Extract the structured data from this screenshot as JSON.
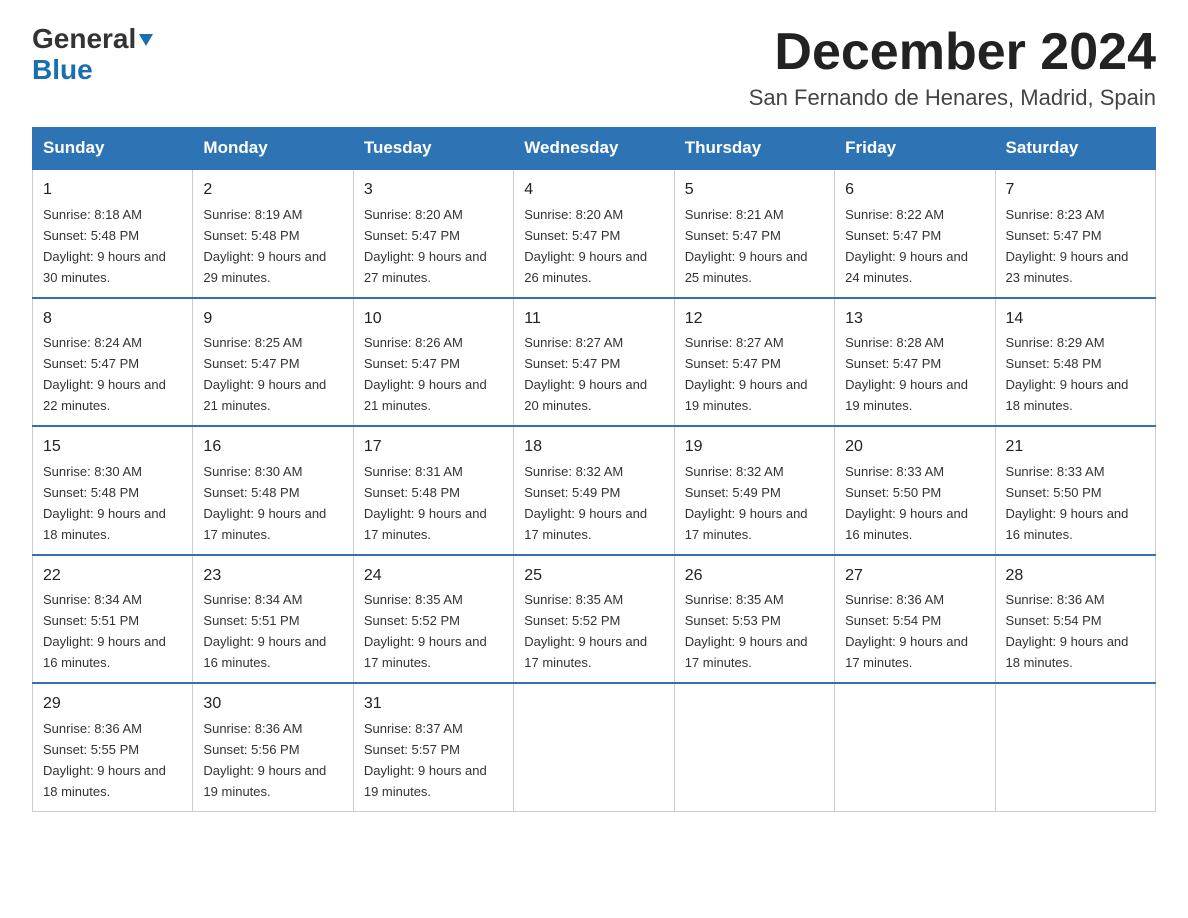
{
  "logo": {
    "general": "General",
    "blue": "Blue"
  },
  "title": {
    "month_year": "December 2024",
    "location": "San Fernando de Henares, Madrid, Spain"
  },
  "weekdays": [
    "Sunday",
    "Monday",
    "Tuesday",
    "Wednesday",
    "Thursday",
    "Friday",
    "Saturday"
  ],
  "weeks": [
    [
      {
        "day": "1",
        "sunrise": "8:18 AM",
        "sunset": "5:48 PM",
        "daylight": "9 hours and 30 minutes."
      },
      {
        "day": "2",
        "sunrise": "8:19 AM",
        "sunset": "5:48 PM",
        "daylight": "9 hours and 29 minutes."
      },
      {
        "day": "3",
        "sunrise": "8:20 AM",
        "sunset": "5:47 PM",
        "daylight": "9 hours and 27 minutes."
      },
      {
        "day": "4",
        "sunrise": "8:20 AM",
        "sunset": "5:47 PM",
        "daylight": "9 hours and 26 minutes."
      },
      {
        "day": "5",
        "sunrise": "8:21 AM",
        "sunset": "5:47 PM",
        "daylight": "9 hours and 25 minutes."
      },
      {
        "day": "6",
        "sunrise": "8:22 AM",
        "sunset": "5:47 PM",
        "daylight": "9 hours and 24 minutes."
      },
      {
        "day": "7",
        "sunrise": "8:23 AM",
        "sunset": "5:47 PM",
        "daylight": "9 hours and 23 minutes."
      }
    ],
    [
      {
        "day": "8",
        "sunrise": "8:24 AM",
        "sunset": "5:47 PM",
        "daylight": "9 hours and 22 minutes."
      },
      {
        "day": "9",
        "sunrise": "8:25 AM",
        "sunset": "5:47 PM",
        "daylight": "9 hours and 21 minutes."
      },
      {
        "day": "10",
        "sunrise": "8:26 AM",
        "sunset": "5:47 PM",
        "daylight": "9 hours and 21 minutes."
      },
      {
        "day": "11",
        "sunrise": "8:27 AM",
        "sunset": "5:47 PM",
        "daylight": "9 hours and 20 minutes."
      },
      {
        "day": "12",
        "sunrise": "8:27 AM",
        "sunset": "5:47 PM",
        "daylight": "9 hours and 19 minutes."
      },
      {
        "day": "13",
        "sunrise": "8:28 AM",
        "sunset": "5:47 PM",
        "daylight": "9 hours and 19 minutes."
      },
      {
        "day": "14",
        "sunrise": "8:29 AM",
        "sunset": "5:48 PM",
        "daylight": "9 hours and 18 minutes."
      }
    ],
    [
      {
        "day": "15",
        "sunrise": "8:30 AM",
        "sunset": "5:48 PM",
        "daylight": "9 hours and 18 minutes."
      },
      {
        "day": "16",
        "sunrise": "8:30 AM",
        "sunset": "5:48 PM",
        "daylight": "9 hours and 17 minutes."
      },
      {
        "day": "17",
        "sunrise": "8:31 AM",
        "sunset": "5:48 PM",
        "daylight": "9 hours and 17 minutes."
      },
      {
        "day": "18",
        "sunrise": "8:32 AM",
        "sunset": "5:49 PM",
        "daylight": "9 hours and 17 minutes."
      },
      {
        "day": "19",
        "sunrise": "8:32 AM",
        "sunset": "5:49 PM",
        "daylight": "9 hours and 17 minutes."
      },
      {
        "day": "20",
        "sunrise": "8:33 AM",
        "sunset": "5:50 PM",
        "daylight": "9 hours and 16 minutes."
      },
      {
        "day": "21",
        "sunrise": "8:33 AM",
        "sunset": "5:50 PM",
        "daylight": "9 hours and 16 minutes."
      }
    ],
    [
      {
        "day": "22",
        "sunrise": "8:34 AM",
        "sunset": "5:51 PM",
        "daylight": "9 hours and 16 minutes."
      },
      {
        "day": "23",
        "sunrise": "8:34 AM",
        "sunset": "5:51 PM",
        "daylight": "9 hours and 16 minutes."
      },
      {
        "day": "24",
        "sunrise": "8:35 AM",
        "sunset": "5:52 PM",
        "daylight": "9 hours and 17 minutes."
      },
      {
        "day": "25",
        "sunrise": "8:35 AM",
        "sunset": "5:52 PM",
        "daylight": "9 hours and 17 minutes."
      },
      {
        "day": "26",
        "sunrise": "8:35 AM",
        "sunset": "5:53 PM",
        "daylight": "9 hours and 17 minutes."
      },
      {
        "day": "27",
        "sunrise": "8:36 AM",
        "sunset": "5:54 PM",
        "daylight": "9 hours and 17 minutes."
      },
      {
        "day": "28",
        "sunrise": "8:36 AM",
        "sunset": "5:54 PM",
        "daylight": "9 hours and 18 minutes."
      }
    ],
    [
      {
        "day": "29",
        "sunrise": "8:36 AM",
        "sunset": "5:55 PM",
        "daylight": "9 hours and 18 minutes."
      },
      {
        "day": "30",
        "sunrise": "8:36 AM",
        "sunset": "5:56 PM",
        "daylight": "9 hours and 19 minutes."
      },
      {
        "day": "31",
        "sunrise": "8:37 AM",
        "sunset": "5:57 PM",
        "daylight": "9 hours and 19 minutes."
      },
      null,
      null,
      null,
      null
    ]
  ]
}
